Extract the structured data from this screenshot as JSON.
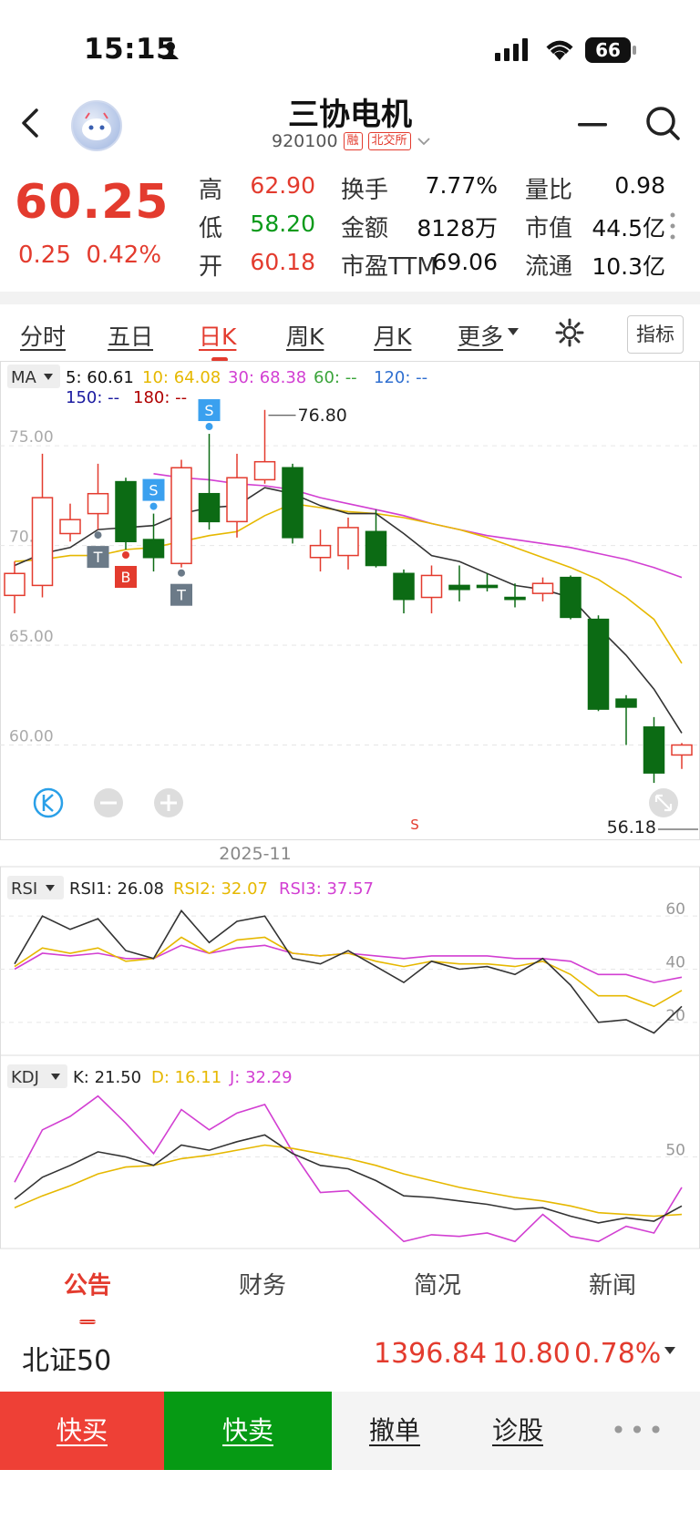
{
  "status_bar": {
    "time": "15:15",
    "battery": "66"
  },
  "header": {
    "title": "三协电机",
    "code": "920100",
    "tag_margin": "融",
    "tag_exchange": "北交所"
  },
  "quote": {
    "price": "60.25",
    "change": "0.25",
    "change_pct": "0.42%",
    "stats": [
      {
        "label": "高",
        "value": "62.90",
        "color": "red"
      },
      {
        "label": "换手",
        "value": "7.77%",
        "color": "black"
      },
      {
        "label": "量比",
        "value": "0.98",
        "color": "black"
      },
      {
        "label": "低",
        "value": "58.20",
        "color": "green"
      },
      {
        "label": "金额",
        "value": "8128万",
        "color": "black"
      },
      {
        "label": "市值",
        "value": "44.5亿",
        "color": "black"
      },
      {
        "label": "开",
        "value": "60.18",
        "color": "red"
      },
      {
        "label": "市盈TTM",
        "value": "69.06",
        "color": "black"
      },
      {
        "label": "流通",
        "value": "10.3亿",
        "color": "black"
      }
    ]
  },
  "tabs": [
    "分时",
    "五日",
    "日K",
    "周K",
    "月K",
    "更多"
  ],
  "active_tab": "日K",
  "indicator_button": "指标",
  "ma_legend": {
    "selector": "MA",
    "items": [
      "5: 60.61",
      "10: 64.08",
      "30: 68.38",
      "60: --",
      "120: --",
      "150: --",
      "180: --"
    ],
    "colors": [
      "#111111",
      "#e6b800",
      "#d23fd2",
      "#3aa43a",
      "#2f6fd0",
      "#1a1aa0",
      "#b00000"
    ]
  },
  "chart_labels": {
    "high_marker": "76.80",
    "low_marker": "56.18",
    "month": "2025-11",
    "s_bottom": "S"
  },
  "rsi_legend": {
    "selector": "RSI",
    "items": [
      "RSI1: 26.08",
      "RSI2: 32.07",
      "RSI3: 37.57"
    ]
  },
  "kdj_legend": {
    "selector": "KDJ",
    "items": [
      "K: 21.50",
      "D: 16.11",
      "J: 32.29"
    ]
  },
  "chart_data": {
    "type": "candlestick",
    "y_ticks": [
      "75.00",
      "70.00",
      "65.00",
      "60.00"
    ],
    "ylim": [
      55.5,
      78.8
    ],
    "candles": [
      {
        "o": 67.5,
        "c": 68.6,
        "h": 69.2,
        "l": 66.6
      },
      {
        "o": 68.0,
        "c": 72.4,
        "h": 74.6,
        "l": 67.4
      },
      {
        "o": 70.6,
        "c": 71.3,
        "h": 72.1,
        "l": 70.2
      },
      {
        "o": 71.6,
        "c": 72.6,
        "h": 74.1,
        "l": 70.8
      },
      {
        "o": 73.2,
        "c": 70.2,
        "h": 73.4,
        "l": 69.8
      },
      {
        "o": 70.3,
        "c": 69.4,
        "h": 71.6,
        "l": 68.7
      },
      {
        "o": 69.1,
        "c": 73.9,
        "h": 74.3,
        "l": 68.9
      },
      {
        "o": 72.6,
        "c": 71.2,
        "h": 75.6,
        "l": 70.8
      },
      {
        "o": 71.2,
        "c": 73.4,
        "h": 74.6,
        "l": 70.4
      },
      {
        "o": 73.3,
        "c": 74.2,
        "h": 76.8,
        "l": 73.1
      },
      {
        "o": 73.9,
        "c": 70.4,
        "h": 74.1,
        "l": 70.1
      },
      {
        "o": 69.4,
        "c": 70.0,
        "h": 70.8,
        "l": 68.7
      },
      {
        "o": 69.5,
        "c": 70.9,
        "h": 71.4,
        "l": 68.8
      },
      {
        "o": 70.7,
        "c": 69.0,
        "h": 71.8,
        "l": 68.9
      },
      {
        "o": 68.6,
        "c": 67.3,
        "h": 68.8,
        "l": 66.6
      },
      {
        "o": 67.4,
        "c": 68.5,
        "h": 69.0,
        "l": 66.6
      },
      {
        "o": 68.0,
        "c": 67.8,
        "h": 69.0,
        "l": 67.2
      },
      {
        "o": 68.0,
        "c": 67.9,
        "h": 68.6,
        "l": 67.7
      },
      {
        "o": 67.4,
        "c": 67.3,
        "h": 68.1,
        "l": 66.9
      },
      {
        "o": 67.6,
        "c": 68.1,
        "h": 68.4,
        "l": 67.2
      },
      {
        "o": 68.4,
        "c": 66.4,
        "h": 68.5,
        "l": 66.3
      },
      {
        "o": 66.3,
        "c": 61.8,
        "h": 66.5,
        "l": 61.7
      },
      {
        "o": 62.3,
        "c": 61.9,
        "h": 62.5,
        "l": 60.0
      },
      {
        "o": 60.9,
        "c": 58.6,
        "h": 61.4,
        "l": 58.1
      },
      {
        "o": 59.5,
        "c": 60.0,
        "h": 60.1,
        "l": 58.8
      }
    ],
    "ma5": [
      69.0,
      69.6,
      69.9,
      70.8,
      70.9,
      71.0,
      71.6,
      71.9,
      72.0,
      72.9,
      72.6,
      72.0,
      71.6,
      71.6,
      70.6,
      69.5,
      69.2,
      68.6,
      68.0,
      67.8,
      67.4,
      65.9,
      64.5,
      62.8,
      60.6
    ],
    "ma10": [
      69.2,
      69.3,
      69.5,
      69.5,
      69.8,
      69.9,
      70.2,
      70.5,
      70.7,
      71.5,
      72.1,
      71.9,
      71.7,
      71.6,
      71.4,
      71.1,
      70.8,
      70.4,
      69.9,
      69.4,
      68.9,
      68.3,
      67.4,
      66.3,
      64.1
    ],
    "ma30": [
      null,
      null,
      null,
      null,
      null,
      73.6,
      73.4,
      73.3,
      73.1,
      73.0,
      72.8,
      72.4,
      72.1,
      71.8,
      71.5,
      71.1,
      70.8,
      70.5,
      70.3,
      70.1,
      69.9,
      69.6,
      69.3,
      68.9,
      68.4
    ],
    "rsi1": [
      42,
      60,
      55,
      59,
      47,
      44,
      62,
      50,
      58,
      60,
      44,
      42,
      47,
      41,
      35,
      43,
      40,
      41,
      38,
      44,
      34,
      20,
      21,
      16,
      26
    ],
    "rsi2": [
      41,
      48,
      46,
      48,
      43,
      44,
      52,
      46,
      51,
      52,
      46,
      45,
      46,
      43,
      41,
      43,
      42,
      42,
      41,
      43,
      38,
      30,
      30,
      26,
      32
    ],
    "rsi3": [
      40,
      46,
      45,
      46,
      44,
      44,
      49,
      46,
      48,
      49,
      46,
      45,
      46,
      45,
      44,
      45,
      45,
      45,
      44,
      44,
      43,
      38,
      38,
      35,
      37
    ],
    "k": [
      25,
      38,
      45,
      53,
      50,
      45,
      57,
      54,
      59,
      63,
      52,
      45,
      43,
      36,
      27,
      26,
      24,
      22,
      19,
      20,
      15,
      11,
      14,
      12,
      21
    ],
    "d": [
      20,
      27,
      33,
      40,
      44,
      45,
      49,
      51,
      54,
      57,
      55,
      52,
      49,
      45,
      40,
      36,
      32,
      29,
      26,
      24,
      21,
      17,
      16,
      15,
      16
    ],
    "j": [
      35,
      66,
      74,
      86,
      70,
      52,
      78,
      66,
      76,
      81,
      53,
      29,
      30,
      15,
      0,
      4,
      3,
      5,
      0,
      16,
      3,
      0,
      9,
      5,
      32
    ],
    "kdj_tick": "50",
    "rsi_ticks": [
      "60",
      "40",
      "20"
    ],
    "markers": [
      {
        "idx": 3,
        "label": "T",
        "type": "below",
        "color": "#6b7a88"
      },
      {
        "idx": 4,
        "label": "B",
        "type": "below",
        "color": "#e33b2e"
      },
      {
        "idx": 5,
        "label": "S",
        "type": "above",
        "color": "#3aa0ef"
      },
      {
        "idx": 6,
        "label": "T",
        "type": "below",
        "color": "#6b7a88"
      },
      {
        "idx": 7,
        "label": "S",
        "type": "above",
        "color": "#3aa0ef"
      }
    ]
  },
  "bottom_tabs": [
    "公告",
    "财务",
    "简况",
    "新闻"
  ],
  "index_bar": {
    "name": "北证50",
    "price": "1396.84",
    "change": "10.80",
    "pct": "0.78%"
  },
  "actions": {
    "buy": "快买",
    "sell": "快卖",
    "cancel": "撤单",
    "diagnose": "诊股",
    "more": "•••"
  }
}
